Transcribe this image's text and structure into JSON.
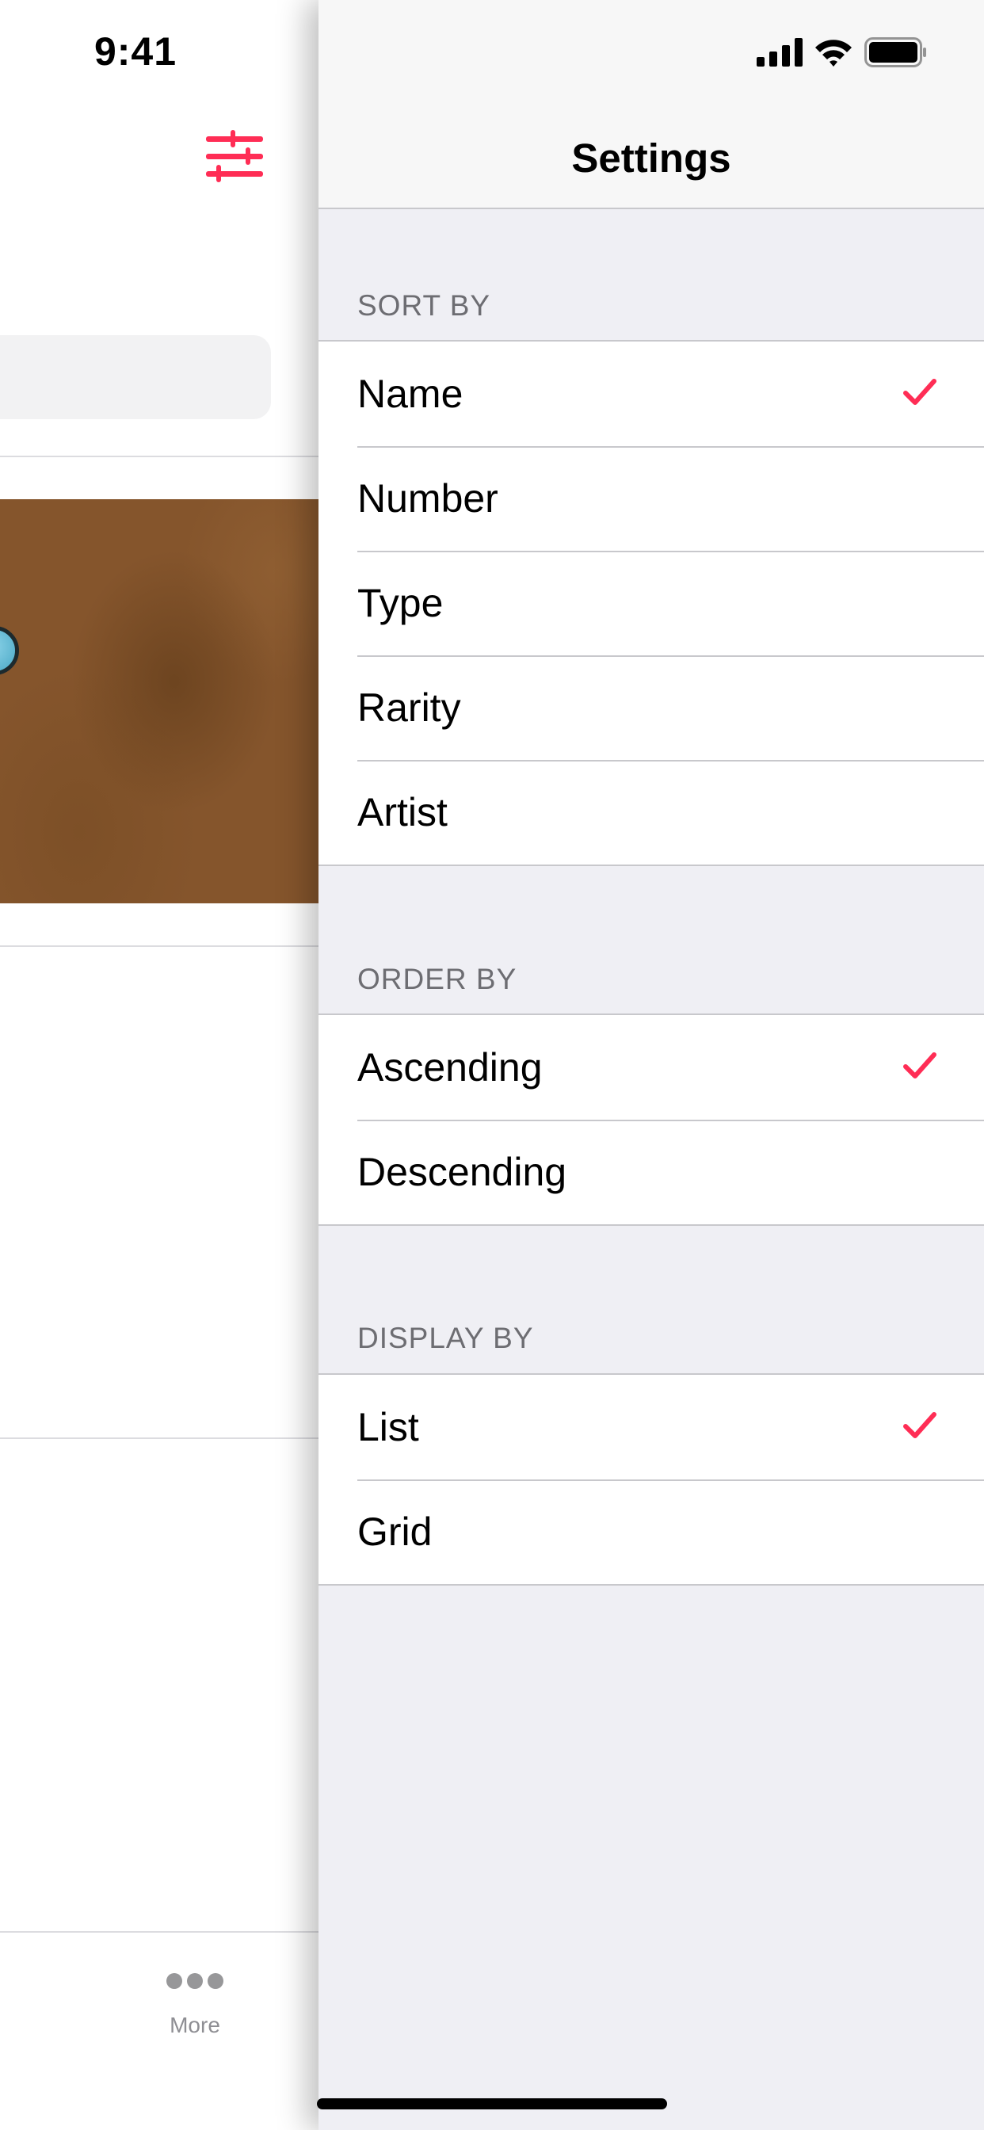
{
  "status_bar": {
    "time": "9:41",
    "icons": [
      "cellular-signal-icon",
      "wifi-icon",
      "battery-icon"
    ]
  },
  "left_screen": {
    "filter_icon": "sliders-icon",
    "tab_bar": {
      "more_label": "More",
      "more_icon": "more-dots-icon"
    }
  },
  "settings": {
    "title": "Settings",
    "accent_color": "#ff2d55",
    "sections": [
      {
        "header": "SORT BY",
        "items": [
          {
            "label": "Name",
            "selected": true
          },
          {
            "label": "Number",
            "selected": false
          },
          {
            "label": "Type",
            "selected": false
          },
          {
            "label": "Rarity",
            "selected": false
          },
          {
            "label": "Artist",
            "selected": false
          }
        ]
      },
      {
        "header": "ORDER BY",
        "items": [
          {
            "label": "Ascending",
            "selected": true
          },
          {
            "label": "Descending",
            "selected": false
          }
        ]
      },
      {
        "header": "DISPLAY BY",
        "items": [
          {
            "label": "List",
            "selected": true
          },
          {
            "label": "Grid",
            "selected": false
          }
        ]
      }
    ]
  }
}
